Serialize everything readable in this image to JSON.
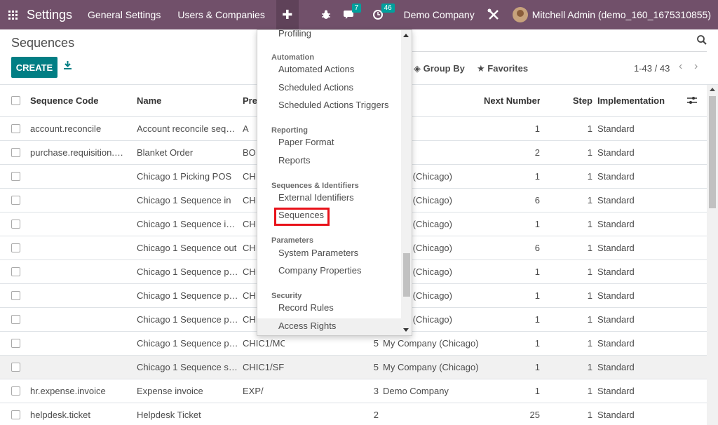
{
  "navbar": {
    "brand": "Settings",
    "menu": [
      "General Settings",
      "Users & Companies"
    ],
    "plus": "✚",
    "messages_badge": "7",
    "activities_badge": "46",
    "company": "Demo Company",
    "user": "Mitchell Admin (demo_160_1675310855)"
  },
  "control": {
    "title": "Sequences",
    "create": "CREATE",
    "group_by": "Group By",
    "favorites": "Favorites",
    "pager": "1-43 / 43"
  },
  "table": {
    "headers": {
      "code": "Sequence Code",
      "name": "Name",
      "prefix": "Pre",
      "company": "ny",
      "next": "Next Number",
      "step": "Step",
      "impl": "Implementation"
    },
    "rows": [
      {
        "code": "account.reconcile",
        "name": "Account reconcile sequ...",
        "prefix": "A",
        "pad": "",
        "company": "",
        "next": "1",
        "step": "1",
        "impl": "Standard"
      },
      {
        "code": "purchase.requisition.bl...",
        "name": "Blanket Order",
        "prefix": "BO",
        "pad": "",
        "company": "",
        "next": "2",
        "step": "1",
        "impl": "Standard"
      },
      {
        "code": "",
        "name": "Chicago 1 Picking POS",
        "prefix": "CHI",
        "pad": "",
        "company": "mpany (Chicago)",
        "next": "1",
        "step": "1",
        "impl": "Standard"
      },
      {
        "code": "",
        "name": "Chicago 1 Sequence in",
        "prefix": "CHI",
        "pad": "",
        "company": "mpany (Chicago)",
        "next": "6",
        "step": "1",
        "impl": "Standard"
      },
      {
        "code": "",
        "name": "Chicago 1 Sequence int...",
        "prefix": "CHI",
        "pad": "",
        "company": "mpany (Chicago)",
        "next": "1",
        "step": "1",
        "impl": "Standard"
      },
      {
        "code": "",
        "name": "Chicago 1 Sequence out",
        "prefix": "CHI",
        "pad": "",
        "company": "mpany (Chicago)",
        "next": "6",
        "step": "1",
        "impl": "Standard"
      },
      {
        "code": "",
        "name": "Chicago 1 Sequence pa...",
        "prefix": "CHI",
        "pad": "",
        "company": "mpany (Chicago)",
        "next": "1",
        "step": "1",
        "impl": "Standard"
      },
      {
        "code": "",
        "name": "Chicago 1 Sequence pi...",
        "prefix": "CHI",
        "pad": "",
        "company": "mpany (Chicago)",
        "next": "1",
        "step": "1",
        "impl": "Standard"
      },
      {
        "code": "",
        "name": "Chicago 1 Sequence pi...",
        "prefix": "CHI",
        "pad": "",
        "company": "mpany (Chicago)",
        "next": "1",
        "step": "1",
        "impl": "Standard"
      },
      {
        "code": "",
        "name": "Chicago 1 Sequence pr...",
        "prefix": "CHIC1/MO/",
        "pad": "5",
        "company": "My Company (Chicago)",
        "next": "1",
        "step": "1",
        "impl": "Standard"
      },
      {
        "code": "",
        "name": "Chicago 1 Sequence st...",
        "prefix": "CHIC1/SFP/",
        "pad": "5",
        "company": "My Company (Chicago)",
        "next": "1",
        "step": "1",
        "impl": "Standard"
      },
      {
        "code": "hr.expense.invoice",
        "name": "Expense invoice",
        "prefix": "EXP/",
        "pad": "3",
        "company": "Demo Company",
        "next": "1",
        "step": "1",
        "impl": "Standard"
      },
      {
        "code": "helpdesk.ticket",
        "name": "Helpdesk Ticket",
        "prefix": "",
        "pad": "2",
        "company": "",
        "next": "25",
        "step": "1",
        "impl": "Standard"
      }
    ]
  },
  "dropdown": {
    "items": [
      {
        "type": "item",
        "label": "Profiling"
      },
      {
        "type": "header",
        "label": "Automation"
      },
      {
        "type": "item",
        "label": "Automated Actions"
      },
      {
        "type": "item",
        "label": "Scheduled Actions"
      },
      {
        "type": "item",
        "label": "Scheduled Actions Triggers"
      },
      {
        "type": "header",
        "label": "Reporting"
      },
      {
        "type": "item",
        "label": "Paper Format"
      },
      {
        "type": "item",
        "label": "Reports"
      },
      {
        "type": "header",
        "label": "Sequences & Identifiers"
      },
      {
        "type": "item",
        "label": "External Identifiers"
      },
      {
        "type": "item",
        "label": "Sequences"
      },
      {
        "type": "header",
        "label": "Parameters"
      },
      {
        "type": "item",
        "label": "System Parameters"
      },
      {
        "type": "item",
        "label": "Company Properties"
      },
      {
        "type": "header",
        "label": "Security"
      },
      {
        "type": "item",
        "label": "Record Rules"
      },
      {
        "type": "item",
        "label": "Access Rights"
      }
    ]
  },
  "colors": {
    "navbar": "#71506a",
    "primary": "#017e84",
    "badge": "#00a09d",
    "highlight_box": "#e8121a"
  }
}
